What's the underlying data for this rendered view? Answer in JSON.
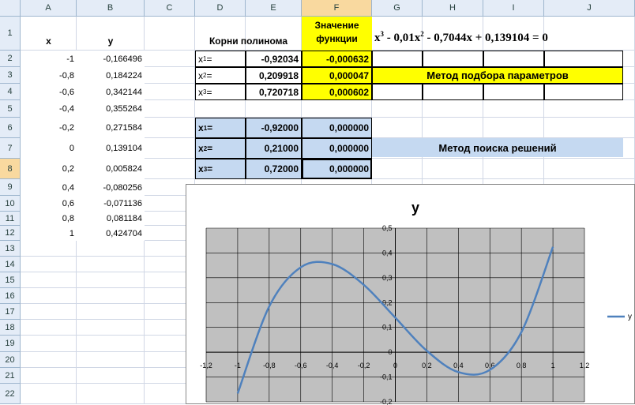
{
  "columns": [
    "A",
    "B",
    "C",
    "D",
    "E",
    "F",
    "G",
    "H",
    "I",
    "J"
  ],
  "rows": [
    "1",
    "2",
    "3",
    "4",
    "5",
    "6",
    "7",
    "8",
    "9",
    "10",
    "11",
    "12",
    "13",
    "14",
    "15",
    "16",
    "17",
    "18",
    "19",
    "20",
    "21",
    "22"
  ],
  "headers": {
    "x": "x",
    "y": "y",
    "roots_title": "Корни полинома",
    "fval_title_1": "Значение",
    "fval_title_2": "функции"
  },
  "equation": {
    "t1": "x",
    "p1": "3",
    "t2": " - 0,01x",
    "p2": "2",
    "t3": " - 0,7044x + 0,139104 = 0"
  },
  "table_xy": [
    {
      "x": "-1",
      "y": "-0,166496"
    },
    {
      "x": "-0,8",
      "y": "0,184224"
    },
    {
      "x": "-0,6",
      "y": "0,342144"
    },
    {
      "x": "-0,4",
      "y": "0,355264"
    },
    {
      "x": "-0,2",
      "y": "0,271584"
    },
    {
      "x": "0",
      "y": "0,139104"
    },
    {
      "x": "0,2",
      "y": "0,005824"
    },
    {
      "x": "0,4",
      "y": "-0,080256"
    },
    {
      "x": "0,6",
      "y": "-0,071136"
    },
    {
      "x": "0,8",
      "y": "0,081184"
    },
    {
      "x": "1",
      "y": "0,424704"
    }
  ],
  "params_method": {
    "rows": [
      {
        "label": "x",
        "sub": "1",
        "suffix": "=",
        "root": "-0,92034",
        "fval": "-0,000632"
      },
      {
        "label": "x",
        "sub": "2",
        "suffix": "=",
        "root": "0,209918",
        "fval": "0,000047"
      },
      {
        "label": "x",
        "sub": "3",
        "suffix": "=",
        "root": "0,720718",
        "fval": "0,000602"
      }
    ],
    "title": "Метод подбора параметров"
  },
  "solver_method": {
    "rows": [
      {
        "label": "x",
        "sub": "1",
        "suffix": "=",
        "root": "-0,92000",
        "fval": "0,000000"
      },
      {
        "label": "x",
        "sub": "2",
        "suffix": "=",
        "root": "0,21000",
        "fval": "0,000000"
      },
      {
        "label": "x",
        "sub": "3",
        "suffix": "=",
        "root": "0,72000",
        "fval": "0,000000"
      }
    ],
    "title": "Метод поиска решений"
  },
  "colors": {
    "yellow": "#ffff00",
    "blue": "#c5d9f1",
    "plot_bg": "#c0c0c0",
    "series": "#4f81bd"
  },
  "chart_data": {
    "type": "line",
    "title": "y",
    "xlim": [
      -1.2,
      1.2
    ],
    "ylim": [
      -0.2,
      0.5
    ],
    "x_ticks": [
      "-1,2",
      "-1",
      "-0,8",
      "-0,6",
      "-0,4",
      "-0,2",
      "0",
      "0,2",
      "0,4",
      "0,6",
      "0,8",
      "1",
      "1,2"
    ],
    "y_ticks": [
      "-0,2",
      "-0,1",
      "0",
      "0,1",
      "0,2",
      "0,3",
      "0,4",
      "0,5"
    ],
    "grid": true,
    "legend": "right",
    "series": [
      {
        "name": "y",
        "x": [
          -1,
          -0.8,
          -0.6,
          -0.4,
          -0.2,
          0,
          0.2,
          0.4,
          0.6,
          0.8,
          1
        ],
        "y": [
          -0.166496,
          0.184224,
          0.342144,
          0.355264,
          0.271584,
          0.139104,
          0.005824,
          -0.080256,
          -0.071136,
          0.081184,
          0.424704
        ]
      }
    ]
  }
}
